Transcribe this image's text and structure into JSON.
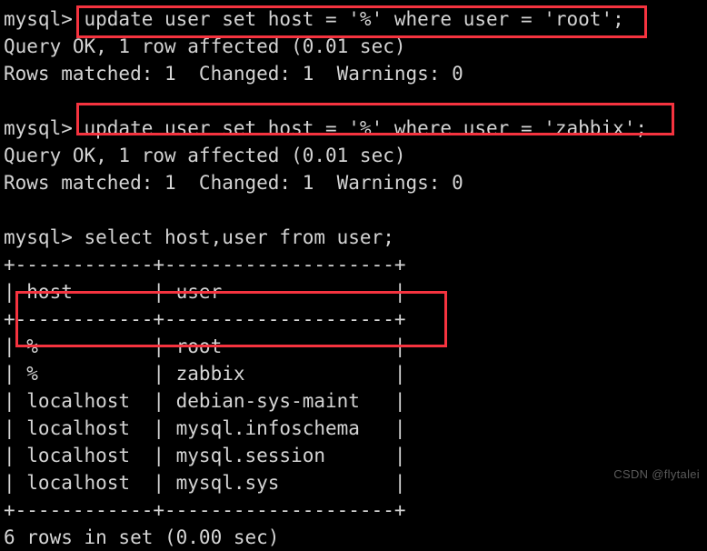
{
  "terminal": {
    "prompt": "mysql>",
    "background_color": "#000000",
    "text_color": "#d4d4d4",
    "highlight_color": "#f5333f",
    "lines": [
      "mysql> update user set host = '%' where user = 'root';",
      "Query OK, 1 row affected (0.01 sec)",
      "Rows matched: 1  Changed: 1  Warnings: 0",
      "",
      "mysql> update user set host = '%' where user = 'zabbix';",
      "Query OK, 1 row affected (0.01 sec)",
      "Rows matched: 1  Changed: 1  Warnings: 0",
      "",
      "mysql> select host,user from user;",
      "+------------+--------------------+",
      "| host       | user               |",
      "+------------+--------------------+",
      "| %          | root               |",
      "| %          | zabbix             |",
      "| localhost  | debian-sys-maint   |",
      "| localhost  | mysql.infoschema   |",
      "| localhost  | mysql.session      |",
      "| localhost  | mysql.sys          |",
      "+------------+--------------------+",
      "6 rows in set (0.00 sec)"
    ],
    "commands": [
      {
        "label": "update user set host = '%' where user = 'root';",
        "highlighted": true
      },
      {
        "label": "update user set host = '%' where user = 'zabbix';",
        "highlighted": true
      },
      {
        "label": "select host,user from user;",
        "highlighted": false
      }
    ],
    "results": [
      {
        "status": "Query OK, 1 row affected (0.01 sec)",
        "detail": "Rows matched: 1  Changed: 1  Warnings: 0"
      },
      {
        "status": "Query OK, 1 row affected (0.01 sec)",
        "detail": "Rows matched: 1  Changed: 1  Warnings: 0"
      }
    ],
    "table": {
      "columns": [
        "host",
        "user"
      ],
      "rows": [
        {
          "host": "%",
          "user": "root",
          "highlighted": true
        },
        {
          "host": "%",
          "user": "zabbix",
          "highlighted": true
        },
        {
          "host": "localhost",
          "user": "debian-sys-maint",
          "highlighted": false
        },
        {
          "host": "localhost",
          "user": "mysql.infoschema",
          "highlighted": false
        },
        {
          "host": "localhost",
          "user": "mysql.session",
          "highlighted": false
        },
        {
          "host": "localhost",
          "user": "mysql.sys",
          "highlighted": false
        }
      ],
      "footer": "6 rows in set (0.00 sec)",
      "row_count": 6
    }
  },
  "watermark": {
    "text": "CSDN @flytalei"
  }
}
